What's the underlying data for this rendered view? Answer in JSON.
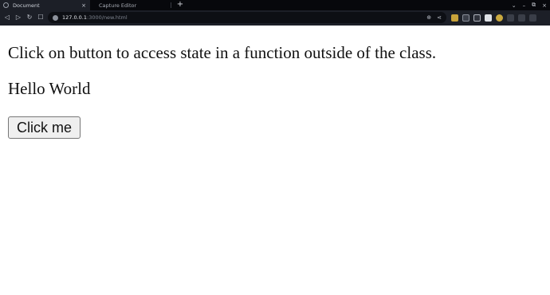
{
  "browser": {
    "tabs": [
      {
        "title": "Document",
        "active": true,
        "close": "×"
      },
      {
        "title": "Capture Editor",
        "active": false
      }
    ],
    "new_tab": "+",
    "window_controls": {
      "collapse": "⌄",
      "minimize": "–",
      "restore": "⧉",
      "close": "×"
    },
    "nav": {
      "back": "◁",
      "forward": "▷",
      "reload": "↻",
      "bookmark": "☐"
    },
    "url": {
      "host": "127.0.0.1",
      "rest": ":3000/new.html"
    },
    "omnibox_icons": {
      "zoom": "⊕",
      "share": "⋖"
    }
  },
  "page": {
    "intro_text": "Click on button to access state in a function outside of the class.",
    "message": "Hello World",
    "button_label": "Click me"
  }
}
